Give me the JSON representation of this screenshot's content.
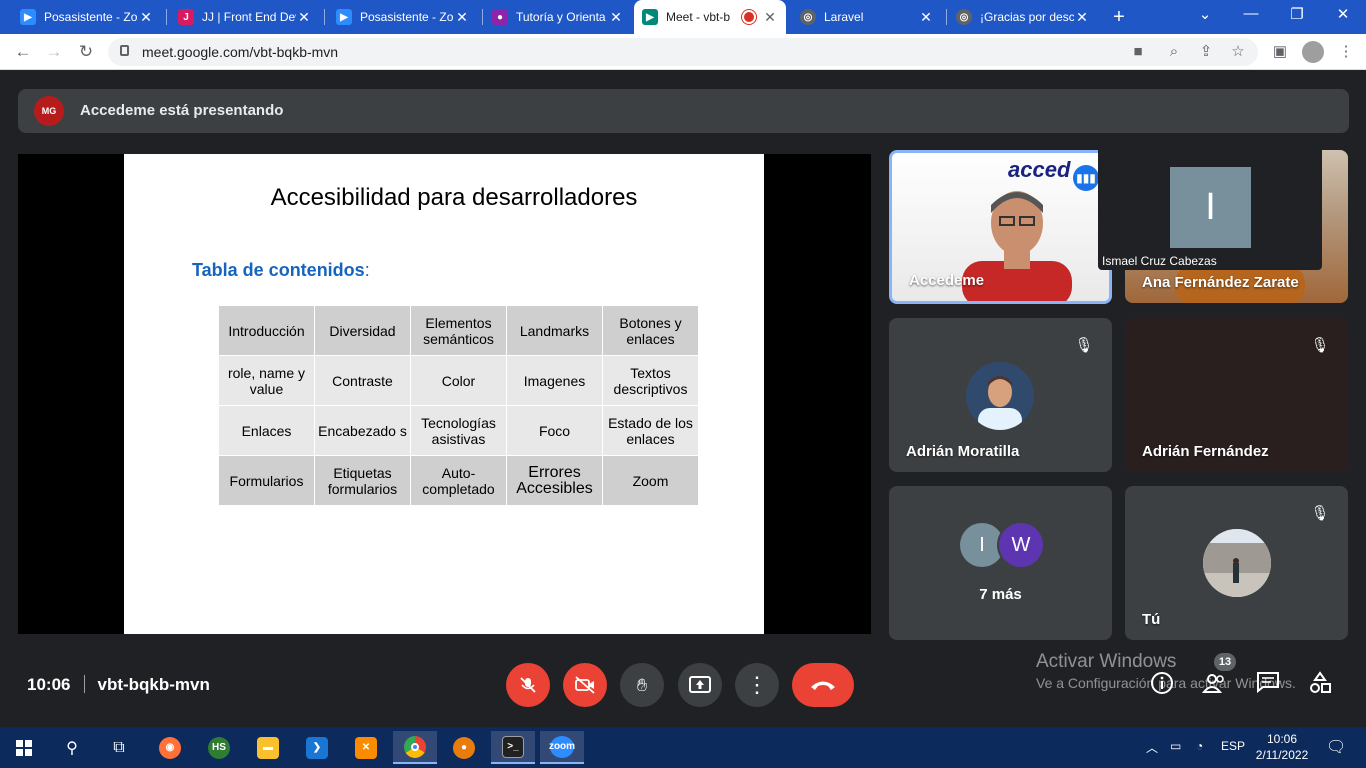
{
  "browser": {
    "tabs": [
      {
        "title": "Posasistente - Zo",
        "icon": "zoom-icon",
        "color": "#2d8cff"
      },
      {
        "title": "JJ | Front End Dev",
        "icon": "jj-icon",
        "color": "#d81b60"
      },
      {
        "title": "Posasistente - Zo",
        "icon": "zoom-icon",
        "color": "#2d8cff"
      },
      {
        "title": "Tutoría y Orienta",
        "icon": "classroom-icon",
        "color": "#8e24aa"
      },
      {
        "title": "Meet - vbt-b",
        "icon": "meet-icon",
        "color": "#00897b",
        "active": true
      },
      {
        "title": "Laravel",
        "icon": "globe-icon",
        "color": "#5f6368"
      },
      {
        "title": "¡Gracias por desc",
        "icon": "globe-icon",
        "color": "#5f6368"
      }
    ],
    "url": "meet.google.com/vbt-bqkb-mvn"
  },
  "meet": {
    "presenting_banner": "Accedeme está presentando",
    "presenter_logo_text": "MG",
    "slide": {
      "title": "Accesibilidad para desarrolladores",
      "subtitle": "Tabla de contenidos",
      "subtitle_suffix": ":",
      "table": [
        [
          "Introducción",
          "Diversidad",
          "Elementos semánticos",
          "Landmarks",
          "Botones y enlaces"
        ],
        [
          "role, name y value",
          "Contraste",
          "Color",
          "Imagenes",
          "Textos descriptivos"
        ],
        [
          "Enlaces",
          "Encabezado s",
          "Tecnologías asistivas",
          "Foco",
          "Estado de los enlaces"
        ],
        [
          "Formularios",
          "Etiquetas formularios",
          "Auto- completado",
          "Errores Accesibles",
          "Zoom"
        ]
      ]
    },
    "tiles": {
      "accedeme": {
        "name": "Accedeme",
        "brand": "acced"
      },
      "ana": {
        "name": "Ana Fernández Zarate"
      },
      "adrian_m": {
        "name": "Adrián Moratilla"
      },
      "adrian_f": {
        "name": "Adrián Fernández"
      },
      "more": {
        "label": "7 más",
        "avatars": [
          "I",
          "W"
        ],
        "colors": [
          "#78909c",
          "#5e35b1"
        ]
      },
      "you": {
        "name": "Tú"
      }
    },
    "pip": {
      "name": "Ismael Cruz Cabezas",
      "initial": "I"
    },
    "time": "10:06",
    "meeting_code": "vbt-bqkb-mvn",
    "people_count": "13",
    "activate_windows_title": "Activar Windows",
    "activate_windows_sub": "Ve a Configuración para activar Windows."
  },
  "taskbar": {
    "time": "10:06",
    "date": "2/11/2022",
    "lang": "ESP",
    "apps": [
      "firefox-icon",
      "hs-icon",
      "file-explorer-icon",
      "vscode-icon",
      "xampp-icon",
      "chrome-icon",
      "blender-icon",
      "terminal-icon",
      "zoom-icon"
    ]
  },
  "colors": {
    "accent": "#8ab4f8",
    "danger": "#ea4335",
    "tile_bg": "#3c4043",
    "bg": "#202124",
    "link_blue": "#1565c0"
  }
}
